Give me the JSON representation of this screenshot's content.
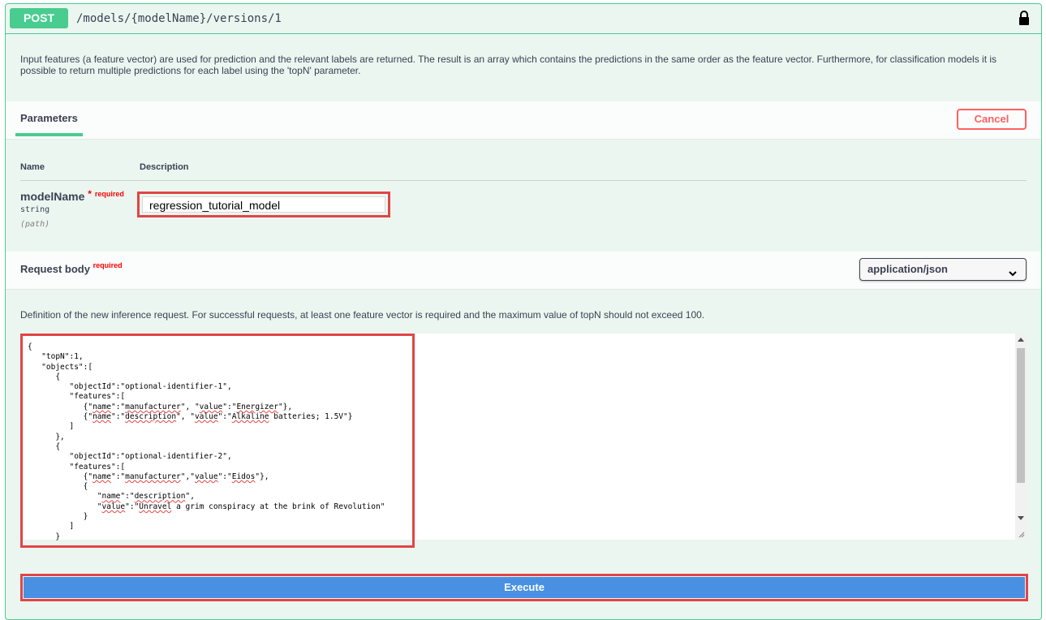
{
  "operation": {
    "method": "POST",
    "path": "/models/{modelName}/versions/1",
    "description": "Input features (a feature vector) are used for prediction and the relevant labels are returned. The result is an array which contains the predictions in the same order as the feature vector. Furthermore, for classification models it is possible to return multiple predictions for each label using the 'topN' parameter."
  },
  "parameters": {
    "tab_label": "Parameters",
    "cancel_label": "Cancel",
    "col_name": "Name",
    "col_description": "Description",
    "items": [
      {
        "name": "modelName",
        "required_star": "*",
        "required_label": "required",
        "type": "string",
        "in": "(path)",
        "value": "regression_tutorial_model"
      }
    ]
  },
  "request_body": {
    "title": "Request body",
    "required_label": "required",
    "content_type": "application/json",
    "description": "Definition of the new inference request. For successful requests, at least one feature vector is required and the maximum value of topN should not exceed 100.",
    "code_lines": [
      "{",
      "   \"topN\":1,",
      "   \"objects\":[",
      "      {",
      "         \"objectId\":\"optional-identifier-1\",",
      "         \"features\":[",
      "            {\"name\":\"manufacturer\", \"value\":\"Energizer\"},",
      "            {\"name\":\"description\", \"value\":\"Alkaline batteries; 1.5V\"}",
      "         ]",
      "      },",
      "      {",
      "         \"objectId\":\"optional-identifier-2\",",
      "         \"features\":[",
      "            {\"name\":\"manufacturer\",\"value\":\"Eidos\"},",
      "            {",
      "               \"name\":\"description\",",
      "               \"value\":\"Unravel a grim conspiracy at the brink of Revolution\"",
      "            }",
      "         ]",
      "      }"
    ]
  },
  "execute_label": "Execute",
  "colors": {
    "post": "#49cc90",
    "execute": "#4990e2",
    "cancel": "#ff6060",
    "highlight": "#e24545"
  },
  "icons": {
    "lock": "lock-icon",
    "chevron": "chevron-down-icon"
  }
}
